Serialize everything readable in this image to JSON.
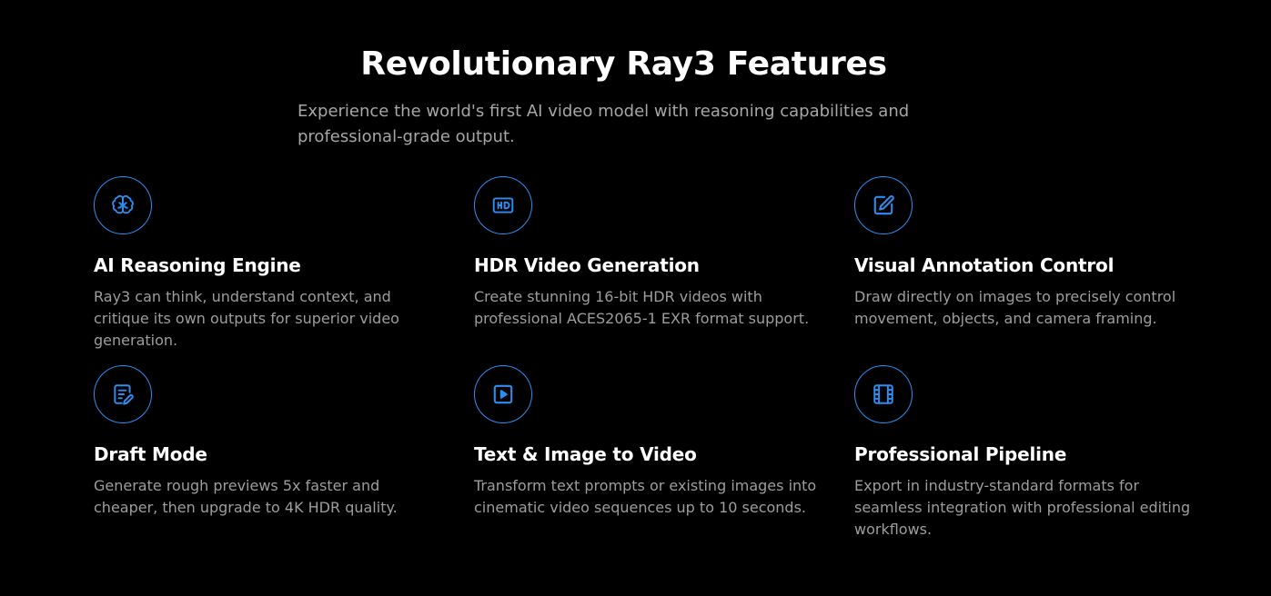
{
  "header": {
    "title": "Revolutionary Ray3 Features",
    "subtitle": "Experience the world's first AI video model with reasoning capabilities and professional-grade output."
  },
  "theme": {
    "background": "#000000",
    "accent": "#2b8ef0",
    "title_color": "#ffffff",
    "body_color": "#9d9d9d"
  },
  "features": [
    {
      "icon": "brain-icon",
      "title": "AI Reasoning Engine",
      "description": "Ray3 can think, understand context, and critique its own outputs for superior video generation."
    },
    {
      "icon": "hd-icon",
      "title": "HDR Video Generation",
      "description": "Create stunning 16-bit HDR videos with professional ACES2065-1 EXR format support."
    },
    {
      "icon": "edit-square-icon",
      "title": "Visual Annotation Control",
      "description": "Draw directly on images to precisely control movement, objects, and camera framing."
    },
    {
      "icon": "draft-document-icon",
      "title": "Draft Mode",
      "description": "Generate rough previews 5x faster and cheaper, then upgrade to 4K HDR quality."
    },
    {
      "icon": "play-square-icon",
      "title": "Text & Image to Video",
      "description": "Transform text prompts or existing images into cinematic video sequences up to 10 seconds."
    },
    {
      "icon": "film-strip-icon",
      "title": "Professional Pipeline",
      "description": "Export in industry-standard formats for seamless integration with professional editing workflows."
    }
  ]
}
